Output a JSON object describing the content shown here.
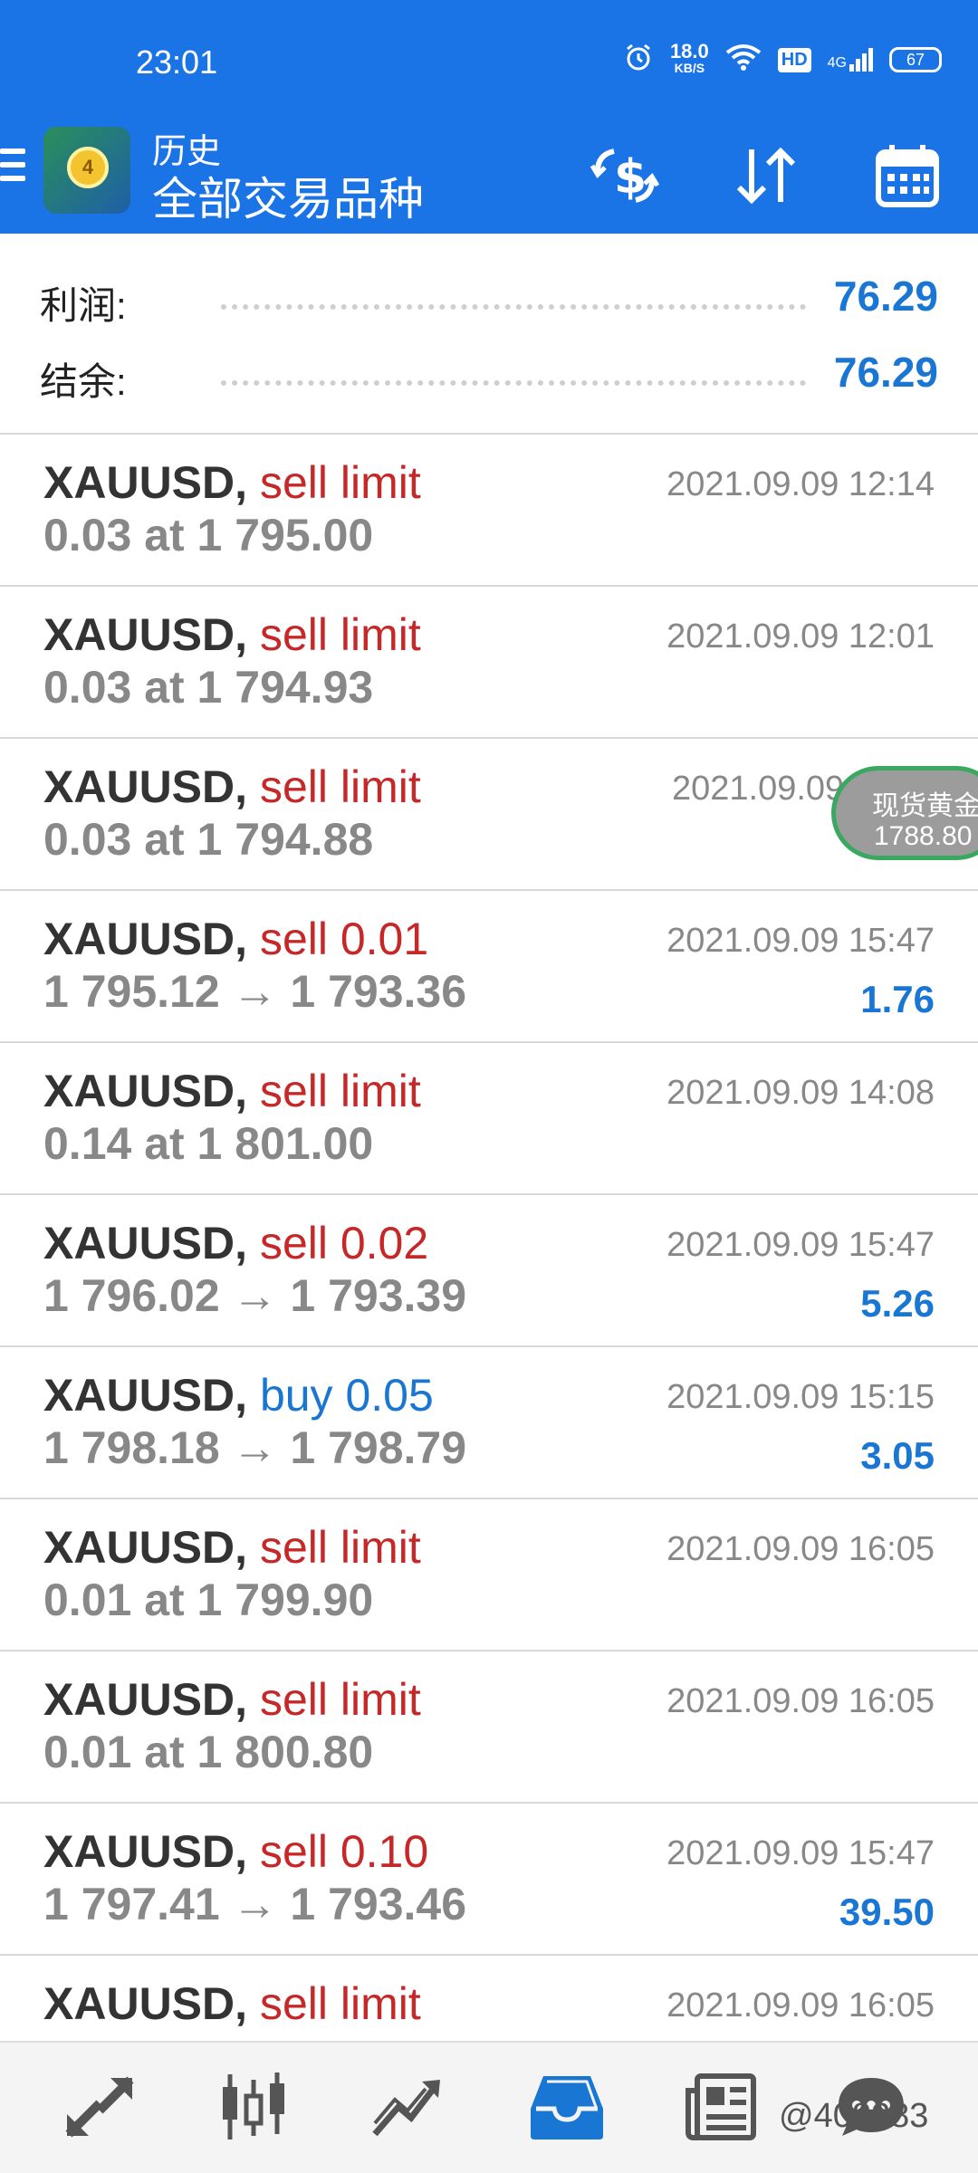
{
  "status_bar": {
    "time": "23:01",
    "net_speed_value": "18.0",
    "net_speed_unit": "KB/S",
    "hd_label": "HD",
    "signal_label": "4G",
    "battery": "67"
  },
  "app_bar": {
    "title": "历史",
    "subtitle": "全部交易品种",
    "logo_letter": "4"
  },
  "summary": {
    "profit_label": "利润:",
    "profit_value": "76.29",
    "balance_label": "结余:",
    "balance_value": "76.29"
  },
  "floating_badge": {
    "line1": "现货黄金",
    "line2": "1788.80"
  },
  "orders": [
    {
      "symbol": "XAUUSD,",
      "action": "sell limit",
      "action_type": "sell",
      "detail": "0.03 at 1 795.00",
      "time": "2021.09.09 12:14",
      "profit": ""
    },
    {
      "symbol": "XAUUSD,",
      "action": "sell limit",
      "action_type": "sell",
      "detail": "0.03 at 1 794.93",
      "time": "2021.09.09 12:01",
      "profit": ""
    },
    {
      "symbol": "XAUUSD,",
      "action": "sell limit",
      "action_type": "sell",
      "detail": "0.03 at 1 794.88",
      "time": "2021.09.09 1",
      "profit": ""
    },
    {
      "symbol": "XAUUSD,",
      "action": "sell 0.01",
      "action_type": "sell",
      "detail": "1 795.12 → 1 793.36",
      "time": "2021.09.09 15:47",
      "profit": "1.76"
    },
    {
      "symbol": "XAUUSD,",
      "action": "sell limit",
      "action_type": "sell",
      "detail": "0.14 at 1 801.00",
      "time": "2021.09.09 14:08",
      "profit": ""
    },
    {
      "symbol": "XAUUSD,",
      "action": "sell 0.02",
      "action_type": "sell",
      "detail": "1 796.02 → 1 793.39",
      "time": "2021.09.09 15:47",
      "profit": "5.26"
    },
    {
      "symbol": "XAUUSD,",
      "action": "buy 0.05",
      "action_type": "buy",
      "detail": "1 798.18 → 1 798.79",
      "time": "2021.09.09 15:15",
      "profit": "3.05"
    },
    {
      "symbol": "XAUUSD,",
      "action": "sell limit",
      "action_type": "sell",
      "detail": "0.01 at 1 799.90",
      "time": "2021.09.09 16:05",
      "profit": ""
    },
    {
      "symbol": "XAUUSD,",
      "action": "sell limit",
      "action_type": "sell",
      "detail": "0.01 at 1 800.80",
      "time": "2021.09.09 16:05",
      "profit": ""
    },
    {
      "symbol": "XAUUSD,",
      "action": "sell 0.10",
      "action_type": "sell",
      "detail": "1 797.41 → 1 793.46",
      "time": "2021.09.09 15:47",
      "profit": "39.50"
    },
    {
      "symbol": "XAUUSD,",
      "action": "sell limit",
      "action_type": "sell",
      "detail": "",
      "time": "2021.09.09 16:05",
      "profit": ""
    }
  ],
  "bottom_nav": {
    "items": [
      {
        "icon": "quotes-arrows-icon",
        "active": false
      },
      {
        "icon": "candlestick-chart-icon",
        "active": false
      },
      {
        "icon": "trade-chart-icon",
        "active": false
      },
      {
        "icon": "history-inbox-icon",
        "active": true
      },
      {
        "icon": "news-icon",
        "active": false
      },
      {
        "icon": "chat-icon",
        "active": false
      }
    ],
    "watermark": "@408283"
  },
  "colors": {
    "primary": "#1a74e6",
    "sell": "#c62828",
    "buy": "#1976d2",
    "profit": "#1976d2",
    "nav_active": "#1976d2",
    "nav_inactive": "#555555"
  }
}
